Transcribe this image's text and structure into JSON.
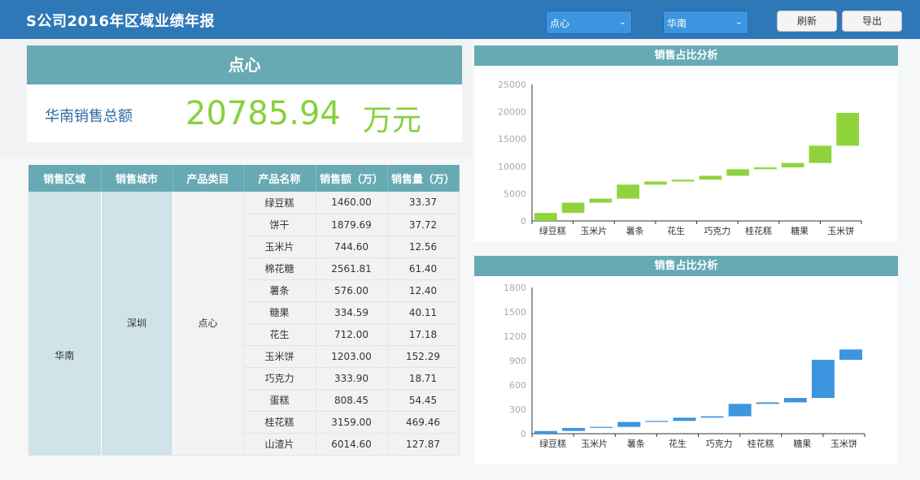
{
  "header": {
    "title": "S公司2016年区域业绩年报",
    "category_select": "点心",
    "region_select": "华南",
    "refresh_label": "刷新",
    "export_label": "导出"
  },
  "summary": {
    "category": "点心",
    "label": "华南销售总额",
    "value": "20785.94",
    "unit": "万元"
  },
  "table": {
    "columns": [
      "销售区域",
      "销售城市",
      "产品类目",
      "产品名称",
      "销售额（万）",
      "销售量（万）"
    ],
    "region": "华南",
    "city": "深圳",
    "category": "点心",
    "rows": [
      {
        "name": "绿豆糕",
        "sales": "1460.00",
        "qty": "33.37"
      },
      {
        "name": "饼干",
        "sales": "1879.69",
        "qty": "37.72"
      },
      {
        "name": "玉米片",
        "sales": "744.60",
        "qty": "12.56"
      },
      {
        "name": "棉花糖",
        "sales": "2561.81",
        "qty": "61.40"
      },
      {
        "name": "薯条",
        "sales": "576.00",
        "qty": "12.40"
      },
      {
        "name": "糖果",
        "sales": "334.59",
        "qty": "40.11"
      },
      {
        "name": "花生",
        "sales": "712.00",
        "qty": "17.18"
      },
      {
        "name": "玉米饼",
        "sales": "1203.00",
        "qty": "152.29"
      },
      {
        "name": "巧克力",
        "sales": "333.90",
        "qty": "18.71"
      },
      {
        "name": "蛋糕",
        "sales": "808.45",
        "qty": "54.45"
      },
      {
        "name": "桂花糕",
        "sales": "3159.00",
        "qty": "469.46"
      },
      {
        "name": "山渣片",
        "sales": "6014.60",
        "qty": "127.87"
      }
    ]
  },
  "chart_data": [
    {
      "type": "bar",
      "subtype": "waterfall",
      "title": "销售占比分析",
      "color": "#8fd43d",
      "categories": [
        "绿豆糕",
        "饼干",
        "玉米片",
        "棉花糖",
        "薯条",
        "糖果",
        "花生",
        "玉米饼",
        "巧克力",
        "蛋糕",
        "桂花糕",
        "山渣片"
      ],
      "x_tick_labels": [
        "绿豆糕",
        "玉米片",
        "薯条",
        "花生",
        "巧克力",
        "桂花糕",
        "糖果",
        "玉米饼"
      ],
      "values": [
        1460,
        1879.69,
        744.6,
        2561.81,
        576,
        334.59,
        712,
        1203,
        333.9,
        808.45,
        3159,
        6014.6
      ],
      "ylim": [
        0,
        25000
      ],
      "yticks": [
        0,
        5000,
        10000,
        15000,
        20000,
        25000
      ]
    },
    {
      "type": "bar",
      "subtype": "waterfall",
      "title": "销售占比分析",
      "color": "#3d95e0",
      "categories": [
        "绿豆糕",
        "饼干",
        "玉米片",
        "棉花糖",
        "薯条",
        "糖果",
        "花生",
        "玉米饼",
        "巧克力",
        "蛋糕",
        "桂花糕",
        "山渣片"
      ],
      "x_tick_labels": [
        "绿豆糕",
        "玉米片",
        "薯条",
        "花生",
        "巧克力",
        "桂花糕",
        "糖果",
        "玉米饼"
      ],
      "values": [
        33.37,
        37.72,
        12.56,
        61.4,
        12.4,
        40.11,
        17.18,
        152.29,
        18.71,
        54.45,
        469.46,
        127.87
      ],
      "ylim": [
        0,
        1800
      ],
      "yticks": [
        0,
        300,
        600,
        900,
        1200,
        1500,
        1800
      ]
    }
  ]
}
